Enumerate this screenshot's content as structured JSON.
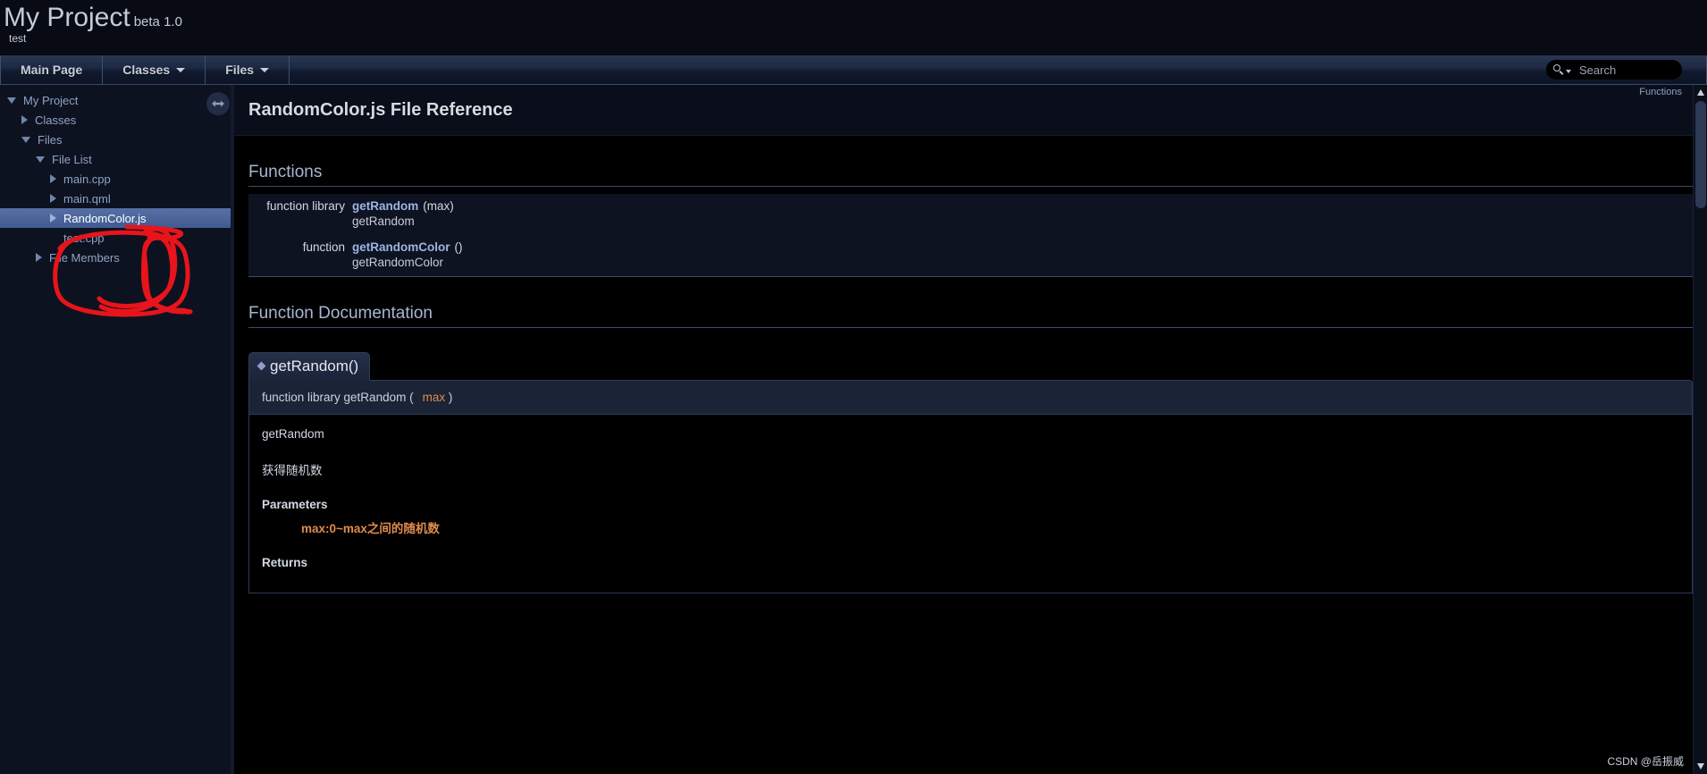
{
  "header": {
    "project_name": "My Project",
    "project_number": "beta 1.0",
    "project_brief": "test"
  },
  "navbar": {
    "tabs": [
      {
        "label": "Main Page",
        "has_caret": false
      },
      {
        "label": "Classes",
        "has_caret": true
      },
      {
        "label": "Files",
        "has_caret": true
      }
    ],
    "search": {
      "placeholder": "Search",
      "value": "",
      "icon": "search-icon"
    }
  },
  "sidebar": {
    "items": [
      {
        "label": "My Project",
        "indent": 0,
        "arrow": "down",
        "selected": false
      },
      {
        "label": "Classes",
        "indent": 1,
        "arrow": "right",
        "selected": false
      },
      {
        "label": "Files",
        "indent": 1,
        "arrow": "down",
        "selected": false
      },
      {
        "label": "File List",
        "indent": 2,
        "arrow": "down",
        "selected": false
      },
      {
        "label": "main.cpp",
        "indent": 3,
        "arrow": "right",
        "selected": false
      },
      {
        "label": "main.qml",
        "indent": 3,
        "arrow": "right",
        "selected": false
      },
      {
        "label": "RandomColor.js",
        "indent": 3,
        "arrow": "right",
        "selected": true
      },
      {
        "label": "test.cpp",
        "indent": 3,
        "arrow": "none",
        "selected": false
      },
      {
        "label": "File Members",
        "indent": 2,
        "arrow": "right",
        "selected": false
      }
    ],
    "splitter_icon": "resize-horizontal-icon"
  },
  "content": {
    "nav_path": "Functions",
    "page_title": "RandomColor.js File Reference",
    "functions_heading": "Functions",
    "function_rows": [
      {
        "left": "function library",
        "name": "getRandom",
        "args": "(max)",
        "description": "getRandom"
      },
      {
        "left": "function",
        "name": "getRandomColor",
        "args": "()",
        "description": "getRandomColor"
      }
    ],
    "documentation_heading": "Function Documentation",
    "member": {
      "title": "getRandom()",
      "proto_prefix": "function library getRandom (",
      "proto_param": "max",
      "proto_suffix": ")",
      "brief": "getRandom",
      "detail": "获得随机数",
      "parameters_label": "Parameters",
      "parameters_text": "max:0~max之间的随机数",
      "returns_label": "Returns"
    }
  },
  "watermark": "CSDN @岳振威",
  "colors": {
    "accent_link": "#9db5e2",
    "param_orange": "#e08a4a",
    "selection_blue": "#4f6aa0",
    "annotation_red": "#e8141b"
  }
}
